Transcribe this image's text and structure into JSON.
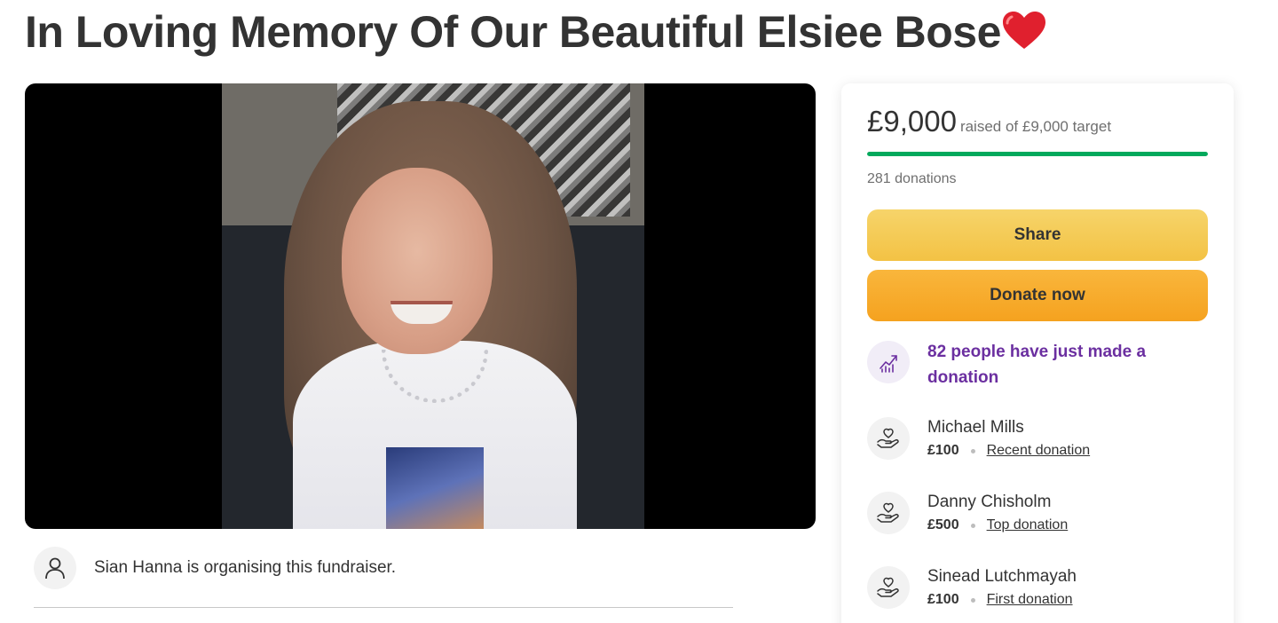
{
  "page": {
    "title": "In Loving Memory Of Our Beautiful Elsiee Bose",
    "title_emoji": "heart-icon"
  },
  "media": {
    "image_name": "fundraiser-photo"
  },
  "organiser": {
    "text": "Sian Hanna is organising this fundraiser.",
    "avatar_icon": "person-icon"
  },
  "donation_card": {
    "amount": "£9,000",
    "amount_sub": "raised of £9,000 target",
    "progress_fraction": 1.0,
    "donations_count": "281 donations",
    "share_label": "Share",
    "donate_label": "Donate now",
    "recent_activity": {
      "icon": "trending-up-icon",
      "text": "82 people have just made a donation"
    },
    "donors": [
      {
        "name": "Michael Mills",
        "amount": "£100",
        "tag": "Recent donation",
        "icon": "heart-hand-icon"
      },
      {
        "name": "Danny Chisholm",
        "amount": "£500",
        "tag": "Top donation",
        "icon": "heart-hand-icon"
      },
      {
        "name": "Sinead Lutchmayah",
        "amount": "£100",
        "tag": "First donation",
        "icon": "heart-hand-icon"
      }
    ]
  },
  "colors": {
    "progress": "#02a95c",
    "share_button": "#f3c244",
    "donate_button": "#f5a21f",
    "accent_purple": "#6b2fa0",
    "heart": "#e0202e"
  }
}
